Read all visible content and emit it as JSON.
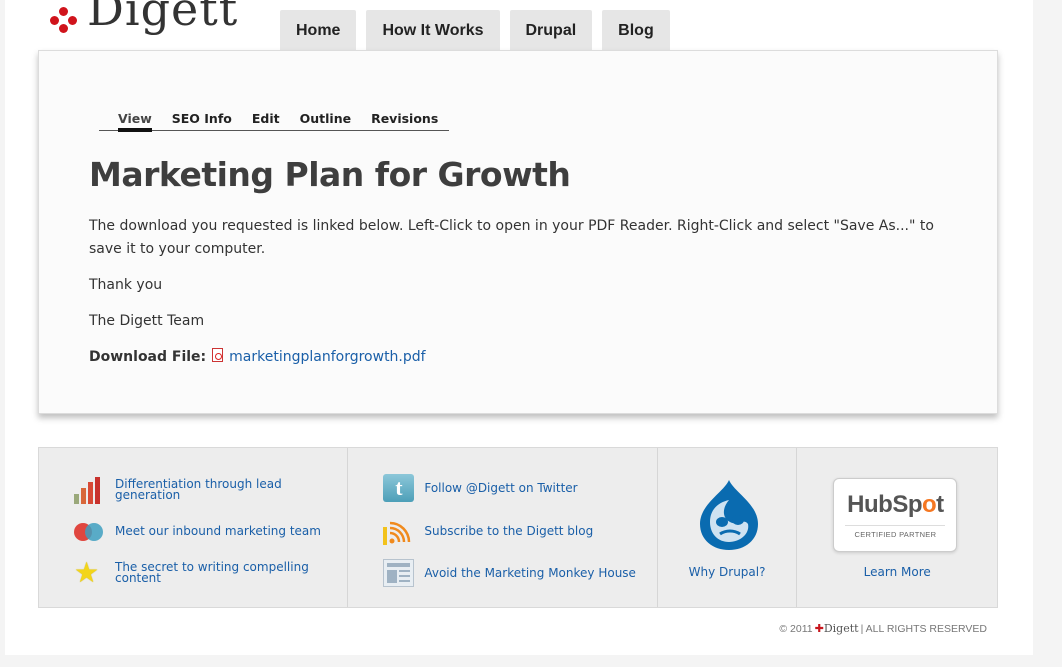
{
  "brand": {
    "logo_text": "Digett",
    "accent_color": "#d0141c"
  },
  "top_nav": {
    "items": [
      {
        "label": "Home"
      },
      {
        "label": "How It Works"
      },
      {
        "label": "Drupal"
      },
      {
        "label": "Blog"
      }
    ]
  },
  "node_tabs": {
    "items": [
      {
        "label": "View",
        "active": true
      },
      {
        "label": "SEO Info"
      },
      {
        "label": "Edit"
      },
      {
        "label": "Outline"
      },
      {
        "label": "Revisions"
      }
    ]
  },
  "article": {
    "title": "Marketing Plan for Growth",
    "paragraphs": [
      "The download you requested is linked below.  Left-Click to open in your PDF Reader. Right-Click and select \"Save As...\" to save it to your computer.",
      "Thank you",
      "The Digett Team"
    ],
    "download_label": "Download File:",
    "download_filename": "marketingplanforgrowth.pdf",
    "download_icon": "pdf-file-icon"
  },
  "footer": {
    "col1": [
      {
        "label": "Differentiation through lead generation",
        "icon": "bar-chart-icon"
      },
      {
        "label": "Meet our inbound marketing team",
        "icon": "overlapping-circles-icon"
      },
      {
        "label": "The secret to writing compelling content",
        "icon": "star-icon"
      }
    ],
    "col2": [
      {
        "label": "Follow @Digett on Twitter",
        "icon": "twitter-icon"
      },
      {
        "label": "Subscribe to the Digett blog",
        "icon": "rss-icon"
      },
      {
        "label": "Avoid the Marketing Monkey House",
        "icon": "newspaper-icon"
      }
    ],
    "drupal": {
      "link": "Why Drupal?",
      "icon": "drupal-drop-icon"
    },
    "hubspot": {
      "logo_text_a": "HubSp",
      "logo_text_o": "o",
      "logo_text_b": "t",
      "badge_sub": "CERTIFIED PARTNER",
      "link": "Learn More"
    }
  },
  "copyright": {
    "prefix": "© 2011",
    "brand": "Digett",
    "suffix": "| ALL RIGHTS RESERVED"
  }
}
